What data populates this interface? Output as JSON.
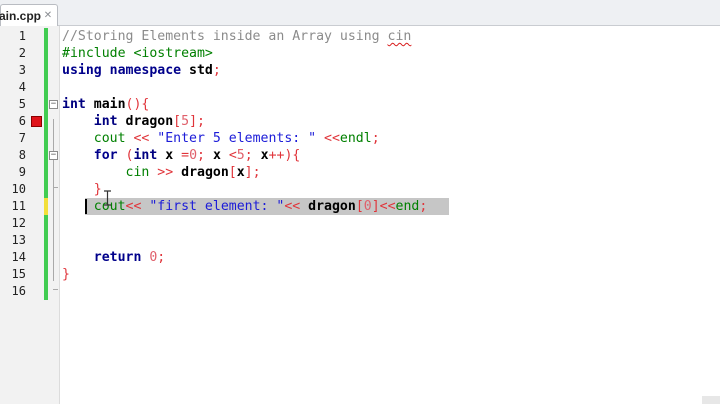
{
  "tab": {
    "label": "ain.cpp",
    "close": "✕"
  },
  "colors": {
    "changed_saved": "#41cc52",
    "changed_unsaved": "#f2df3a",
    "breakpoint": "#e0131a",
    "selection": "#c6c6c6"
  },
  "icons": [
    "breakpoint-icon",
    "fold-toggle-icon",
    "text-cursor-icon",
    "close-icon"
  ],
  "lines": [
    {
      "n": "1",
      "change": "green",
      "tokens": [
        [
          "comment",
          "//Storing Elements inside an Array using "
        ],
        [
          "comment squig",
          "cin"
        ]
      ]
    },
    {
      "n": "2",
      "change": "green",
      "tokens": [
        [
          "pre",
          "#include <iostream>"
        ]
      ]
    },
    {
      "n": "3",
      "change": "green",
      "tokens": [
        [
          "kw",
          "using namespace "
        ],
        [
          "ident",
          "std"
        ],
        [
          "op",
          ";"
        ]
      ]
    },
    {
      "n": "4",
      "change": "green",
      "tokens": []
    },
    {
      "n": "5",
      "change": "green",
      "fold": "−",
      "tokens": [
        [
          "type",
          "int "
        ],
        [
          "ident",
          "main"
        ],
        [
          "op",
          "(){"
        ]
      ]
    },
    {
      "n": "6",
      "change": "green",
      "breakpoint": true,
      "tokens": [
        [
          "plain",
          "    "
        ],
        [
          "type",
          "int "
        ],
        [
          "ident",
          "dragon"
        ],
        [
          "op",
          "["
        ],
        [
          "num",
          "5"
        ],
        [
          "op",
          "];"
        ]
      ]
    },
    {
      "n": "7",
      "change": "green",
      "tokens": [
        [
          "plain",
          "    "
        ],
        [
          "pre",
          "cout "
        ],
        [
          "op",
          "<< "
        ],
        [
          "str",
          "\"Enter 5 elements: \""
        ],
        [
          "op",
          " <<"
        ],
        [
          "pre",
          "endl"
        ],
        [
          "op",
          ";"
        ]
      ]
    },
    {
      "n": "8",
      "change": "green",
      "fold": "−",
      "tokens": [
        [
          "plain",
          "    "
        ],
        [
          "kw",
          "for "
        ],
        [
          "op",
          "("
        ],
        [
          "type",
          "int "
        ],
        [
          "ident",
          "x "
        ],
        [
          "op",
          "="
        ],
        [
          "num",
          "0"
        ],
        [
          "op",
          "; "
        ],
        [
          "ident",
          "x "
        ],
        [
          "op",
          "<"
        ],
        [
          "num",
          "5"
        ],
        [
          "op",
          "; "
        ],
        [
          "ident",
          "x"
        ],
        [
          "op",
          "++){"
        ]
      ]
    },
    {
      "n": "9",
      "change": "green",
      "tokens": [
        [
          "plain",
          "        "
        ],
        [
          "pre",
          "cin "
        ],
        [
          "op",
          ">> "
        ],
        [
          "ident",
          "dragon"
        ],
        [
          "op",
          "["
        ],
        [
          "ident",
          "x"
        ],
        [
          "op",
          "];"
        ]
      ]
    },
    {
      "n": "10",
      "change": "green",
      "tokens": [
        [
          "plain",
          "    "
        ],
        [
          "op",
          "}"
        ]
      ]
    },
    {
      "n": "11",
      "change": "yellow",
      "selected": true,
      "tokens": [
        [
          "plain",
          "    "
        ],
        [
          "pre",
          "cout"
        ],
        [
          "op",
          "<< "
        ],
        [
          "str",
          "\"first element: \""
        ],
        [
          "op",
          "<< "
        ],
        [
          "ident",
          "dragon"
        ],
        [
          "op",
          "["
        ],
        [
          "num",
          "0"
        ],
        [
          "op",
          "]<<"
        ],
        [
          "pre",
          "end"
        ],
        [
          "op",
          ";"
        ]
      ]
    },
    {
      "n": "12",
      "change": "green",
      "tokens": []
    },
    {
      "n": "13",
      "change": "green",
      "tokens": []
    },
    {
      "n": "14",
      "change": "green",
      "tokens": [
        [
          "plain",
          "    "
        ],
        [
          "kw",
          "return "
        ],
        [
          "num",
          "0"
        ],
        [
          "op",
          ";"
        ]
      ]
    },
    {
      "n": "15",
      "change": "green",
      "tokens": [
        [
          "op",
          "}"
        ]
      ]
    },
    {
      "n": "16",
      "change": "green",
      "tokens": []
    }
  ]
}
